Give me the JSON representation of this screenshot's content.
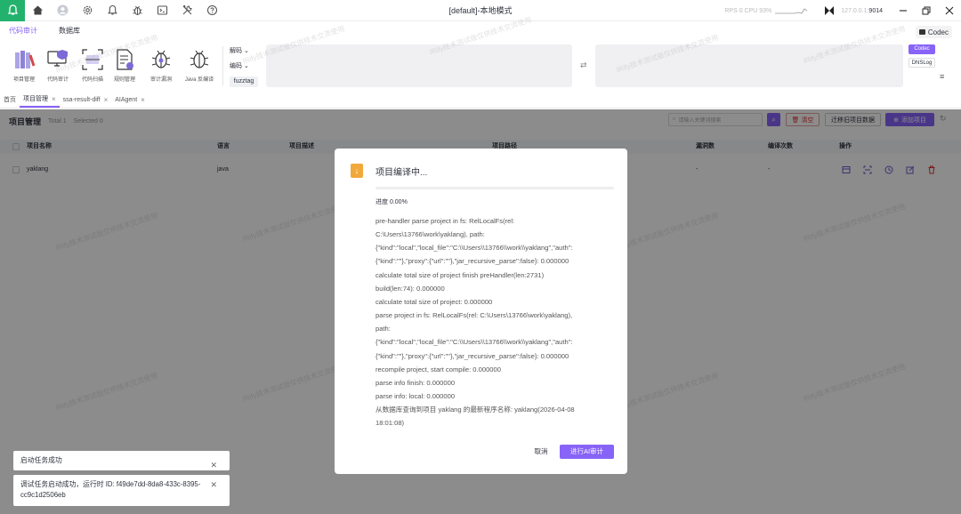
{
  "titlebar": {
    "title": "[default]-本地模式",
    "rps": "RPS 0 CPU 93%",
    "ip": "127.0.0.1:",
    "port": "9014"
  },
  "top_tabs": [
    "代码审计",
    "数据库"
  ],
  "codec_button": "Codec",
  "toolbar": {
    "tools": [
      "项目管理",
      "代码审计",
      "代码扫描",
      "规则管理",
      "审计漏洞",
      "Java 反编译"
    ],
    "decode_label": "解码",
    "encode_label": "编码",
    "fuzztag_label": "fuzztag",
    "codec_tab": "Codec",
    "dnslog_tab": "DNSLog"
  },
  "page_tabs": {
    "home": "首页",
    "items": [
      "项目管理",
      "ssa-result-diff",
      "AIAgent"
    ]
  },
  "project_page": {
    "title": "项目管理",
    "total": "Total 1",
    "selected": "Selected 0",
    "search_placeholder": "请输入关键词搜索",
    "clear_label": "清空",
    "migrate_label": "迁移旧项目数据",
    "add_label": "添加项目",
    "columns": [
      "项目名称",
      "语言",
      "项目描述",
      "项目路径",
      "漏洞数",
      "编译次数",
      "操作"
    ],
    "rows": [
      {
        "name": "yaklang",
        "language": "java",
        "vulns": "-",
        "compiles": "-"
      }
    ]
  },
  "modal": {
    "title": "项目编译中...",
    "progress_label": "进度 0.00%",
    "progress": 0,
    "log_lines": [
      "pre-handler parse project in fs: RelLocalFs(rel:",
      "C:\\Users\\13766\\work\\yaklang), path:",
      "{\"kind\":\"local\",\"local_file\":\"C:\\\\Users\\\\13766\\\\work\\\\yaklang\",\"auth\":",
      "{\"kind\":\"\"},\"proxy\":{\"url\":\"\"},\"jar_recursive_parse\":false}: 0.000000",
      "calculate total size of project finish preHandler(len:2731)",
      "build(len:74): 0.000000",
      "calculate total size of project: 0.000000",
      "parse project in fs: RelLocalFs(rel: C:\\Users\\13766\\work\\yaklang),",
      "path:",
      "{\"kind\":\"local\",\"local_file\":\"C:\\\\Users\\\\13766\\\\work\\\\yaklang\",\"auth\":",
      "{\"kind\":\"\"},\"proxy\":{\"url\":\"\"},\"jar_recursive_parse\":false}: 0.000000",
      "recompile project, start compile: 0.000000",
      "parse info finish: 0.000000",
      "parse info: local: 0.000000",
      "从数据库查询到项目 yaklang 的最新程序名称: yaklang(2026-04-08",
      "18:01:08)"
    ],
    "cancel_label": "取消",
    "ai_label": "进行AI审计"
  },
  "toasts": [
    {
      "text": "启动任务成功"
    },
    {
      "text": "调试任务启动成功，运行时 ID: f49de7dd-8da8-433c-8395-cc9c1d2506eb"
    }
  ],
  "watermark": "IRify技术测试版仅供技术交流使用",
  "colors": {
    "accent": "#8863f7",
    "logo": "#23b26d",
    "danger": "#dd3333",
    "warning": "#f2a93b"
  }
}
